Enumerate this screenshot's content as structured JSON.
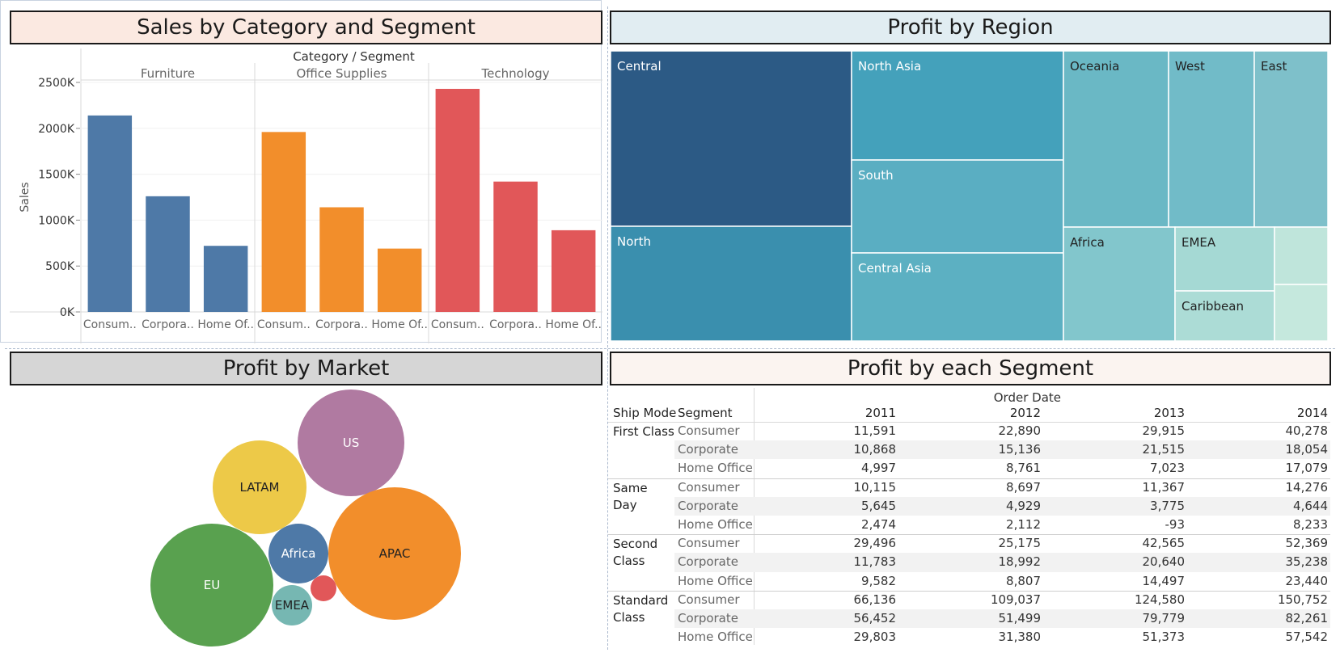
{
  "panels": {
    "sales": {
      "title": "Sales by Category and Segment",
      "title_bg": "#fbe9e1"
    },
    "region": {
      "title": "Profit by Region",
      "title_bg": "#e1edf2"
    },
    "market": {
      "title": "Profit by Market",
      "title_bg": "#d6d6d6"
    },
    "segment": {
      "title": "Profit by each Segment",
      "title_bg": "#fbf4f0"
    }
  },
  "chart_data": [
    {
      "type": "bar",
      "title": "Sales by Category and Segment",
      "header": "Category / Segment",
      "ylabel": "Sales",
      "ylim": [
        0,
        2500000
      ],
      "yticks": [
        "2500K",
        "2000K",
        "1500K",
        "1000K",
        "500K",
        "0K"
      ],
      "yticks_values": [
        2500000,
        2000000,
        1500000,
        1000000,
        500000,
        0
      ],
      "groups": [
        {
          "name": "Furniture",
          "color": "#4e79a7",
          "categories": [
            "Consum..",
            "Corpora..",
            "Home Of.."
          ],
          "values": [
            2140000,
            1260000,
            720000
          ]
        },
        {
          "name": "Office Supplies",
          "color": "#f28e2b",
          "categories": [
            "Consum..",
            "Corpora..",
            "Home Of.."
          ],
          "values": [
            1960000,
            1140000,
            690000
          ]
        },
        {
          "name": "Technology",
          "color": "#e15759",
          "categories": [
            "Consum..",
            "Corpora..",
            "Home Of.."
          ],
          "values": [
            2430000,
            1420000,
            890000
          ]
        }
      ]
    },
    {
      "type": "treemap",
      "title": "Profit by Region",
      "items": [
        {
          "label": "Central",
          "color": "#2c5a85"
        },
        {
          "label": "North",
          "color": "#3a8fae"
        },
        {
          "label": "North Asia",
          "color": "#44a1bb"
        },
        {
          "label": "South",
          "color": "#5aaec2"
        },
        {
          "label": "Central Asia",
          "color": "#5cb0c2"
        },
        {
          "label": "Oceania",
          "color": "#6ab8c5"
        },
        {
          "label": "West",
          "color": "#71bbc8"
        },
        {
          "label": "East",
          "color": "#7ec0ca"
        },
        {
          "label": "Africa",
          "color": "#82c6cc"
        },
        {
          "label": "EMEA",
          "color": "#a5d9d4"
        },
        {
          "label": "Caribbean",
          "color": "#acdcd6"
        },
        {
          "label": "",
          "color": "#bfe5db"
        },
        {
          "label": "",
          "color": "#c5e8dd"
        }
      ]
    },
    {
      "type": "bubble",
      "title": "Profit by Market",
      "items": [
        {
          "label": "US",
          "color": "#b07aa1"
        },
        {
          "label": "LATAM",
          "color": "#edc948"
        },
        {
          "label": "APAC",
          "color": "#f28e2b"
        },
        {
          "label": "EU",
          "color": "#59a14f"
        },
        {
          "label": "Africa",
          "color": "#4e79a7"
        },
        {
          "label": "EMEA",
          "color": "#76b7b2"
        },
        {
          "label": "",
          "color": "#e15759"
        }
      ]
    },
    {
      "type": "table",
      "title": "Profit by each Segment",
      "column_header": "Order Date",
      "row_headers": [
        "Ship Mode",
        "Segment"
      ],
      "columns": [
        "2011",
        "2012",
        "2013",
        "2014"
      ],
      "groups": [
        {
          "ship_mode": "First Class",
          "rows": [
            {
              "segment": "Consumer",
              "values": [
                "11,591",
                "22,890",
                "29,915",
                "40,278"
              ]
            },
            {
              "segment": "Corporate",
              "values": [
                "10,868",
                "15,136",
                "21,515",
                "18,054"
              ]
            },
            {
              "segment": "Home Office",
              "values": [
                "4,997",
                "8,761",
                "7,023",
                "17,079"
              ]
            }
          ]
        },
        {
          "ship_mode": "Same Day",
          "rows": [
            {
              "segment": "Consumer",
              "values": [
                "10,115",
                "8,697",
                "11,367",
                "14,276"
              ]
            },
            {
              "segment": "Corporate",
              "values": [
                "5,645",
                "4,929",
                "3,775",
                "4,644"
              ]
            },
            {
              "segment": "Home Office",
              "values": [
                "2,474",
                "2,112",
                "-93",
                "8,233"
              ]
            }
          ]
        },
        {
          "ship_mode": "Second Class",
          "rows": [
            {
              "segment": "Consumer",
              "values": [
                "29,496",
                "25,175",
                "42,565",
                "52,369"
              ]
            },
            {
              "segment": "Corporate",
              "values": [
                "11,783",
                "18,992",
                "20,640",
                "35,238"
              ]
            },
            {
              "segment": "Home Office",
              "values": [
                "9,582",
                "8,807",
                "14,497",
                "23,440"
              ]
            }
          ]
        },
        {
          "ship_mode": "Standard Class",
          "rows": [
            {
              "segment": "Consumer",
              "values": [
                "66,136",
                "109,037",
                "124,580",
                "150,752"
              ]
            },
            {
              "segment": "Corporate",
              "values": [
                "56,452",
                "51,499",
                "79,779",
                "82,261"
              ]
            },
            {
              "segment": "Home Office",
              "values": [
                "29,803",
                "31,380",
                "51,373",
                "57,542"
              ]
            }
          ]
        }
      ]
    }
  ]
}
